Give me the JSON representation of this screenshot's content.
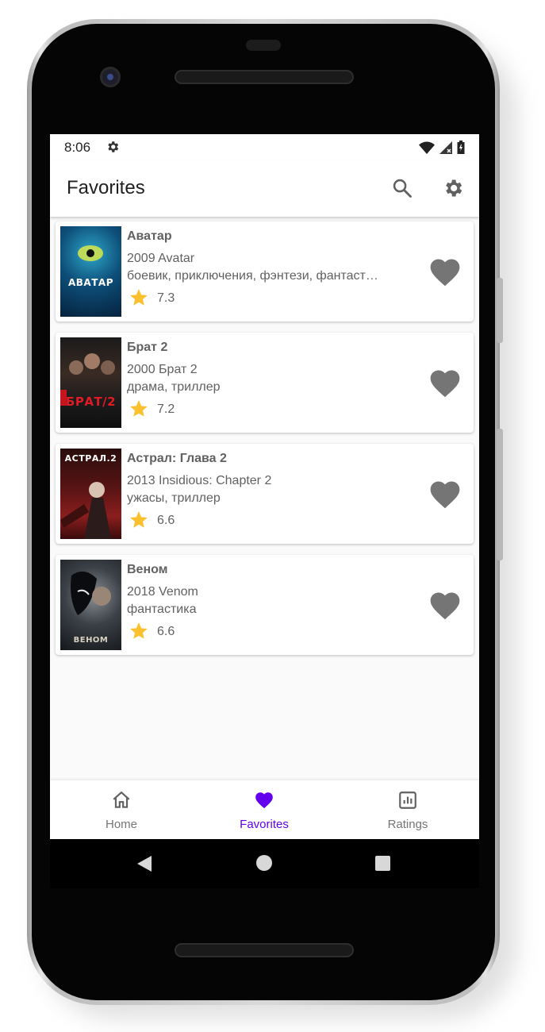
{
  "status_bar": {
    "time": "8:06",
    "icons": [
      "settings-icon",
      "wifi-icon",
      "cell-signal-icon",
      "battery-icon"
    ]
  },
  "app_bar": {
    "title": "Favorites",
    "actions": [
      "search-icon",
      "settings-icon"
    ]
  },
  "favorites": [
    {
      "title": "Аватар",
      "year": "2009",
      "original_title": "Avatar",
      "genres": "боевик, приключения, фэнтези, фантастика",
      "rating": "7.3",
      "poster_text": "АВАТАР"
    },
    {
      "title": "Брат 2",
      "year": "2000",
      "original_title": "Брат 2",
      "genres": "драма, триллер",
      "rating": "7.2",
      "poster_text": "БРАТ/2"
    },
    {
      "title": "Астрал: Глава 2",
      "year": "2013",
      "original_title": "Insidious: Chapter 2",
      "genres": "ужасы, триллер",
      "rating": "6.6",
      "poster_text": "АСТРАЛ.2"
    },
    {
      "title": "Веном",
      "year": "2018",
      "original_title": "Venom",
      "genres": "фантастика",
      "rating": "6.6",
      "poster_text": "ВЕНОМ"
    }
  ],
  "bottom_nav": {
    "items": [
      {
        "label": "Home",
        "icon": "home-icon",
        "active": false
      },
      {
        "label": "Favorites",
        "icon": "heart-icon",
        "active": true
      },
      {
        "label": "Ratings",
        "icon": "bar-chart-icon",
        "active": false
      }
    ]
  },
  "colors": {
    "accent": "#6200ee",
    "star": "#fbc02d",
    "favorite_heart": "#757575",
    "text_secondary": "#616161"
  }
}
